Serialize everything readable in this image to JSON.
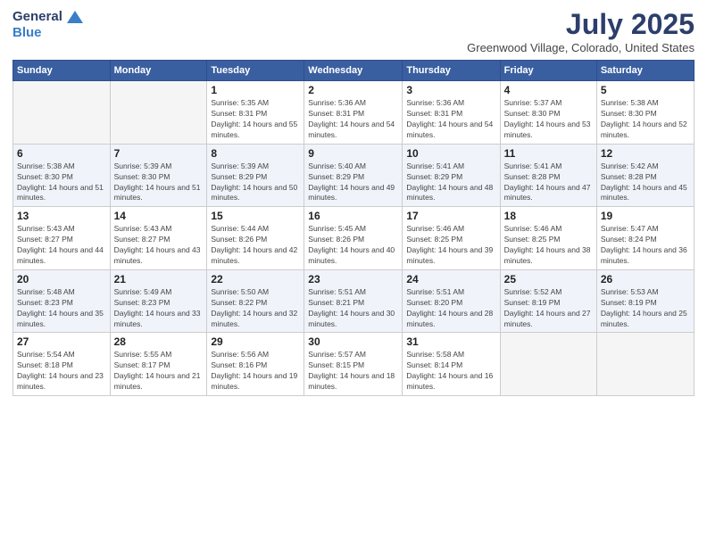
{
  "logo": {
    "general": "General",
    "blue": "Blue"
  },
  "title": "July 2025",
  "location": "Greenwood Village, Colorado, United States",
  "days_header": [
    "Sunday",
    "Monday",
    "Tuesday",
    "Wednesday",
    "Thursday",
    "Friday",
    "Saturday"
  ],
  "weeks": [
    [
      {
        "day": "",
        "info": ""
      },
      {
        "day": "",
        "info": ""
      },
      {
        "day": "1",
        "info": "Sunrise: 5:35 AM\nSunset: 8:31 PM\nDaylight: 14 hours and 55 minutes."
      },
      {
        "day": "2",
        "info": "Sunrise: 5:36 AM\nSunset: 8:31 PM\nDaylight: 14 hours and 54 minutes."
      },
      {
        "day": "3",
        "info": "Sunrise: 5:36 AM\nSunset: 8:31 PM\nDaylight: 14 hours and 54 minutes."
      },
      {
        "day": "4",
        "info": "Sunrise: 5:37 AM\nSunset: 8:30 PM\nDaylight: 14 hours and 53 minutes."
      },
      {
        "day": "5",
        "info": "Sunrise: 5:38 AM\nSunset: 8:30 PM\nDaylight: 14 hours and 52 minutes."
      }
    ],
    [
      {
        "day": "6",
        "info": "Sunrise: 5:38 AM\nSunset: 8:30 PM\nDaylight: 14 hours and 51 minutes."
      },
      {
        "day": "7",
        "info": "Sunrise: 5:39 AM\nSunset: 8:30 PM\nDaylight: 14 hours and 51 minutes."
      },
      {
        "day": "8",
        "info": "Sunrise: 5:39 AM\nSunset: 8:29 PM\nDaylight: 14 hours and 50 minutes."
      },
      {
        "day": "9",
        "info": "Sunrise: 5:40 AM\nSunset: 8:29 PM\nDaylight: 14 hours and 49 minutes."
      },
      {
        "day": "10",
        "info": "Sunrise: 5:41 AM\nSunset: 8:29 PM\nDaylight: 14 hours and 48 minutes."
      },
      {
        "day": "11",
        "info": "Sunrise: 5:41 AM\nSunset: 8:28 PM\nDaylight: 14 hours and 47 minutes."
      },
      {
        "day": "12",
        "info": "Sunrise: 5:42 AM\nSunset: 8:28 PM\nDaylight: 14 hours and 45 minutes."
      }
    ],
    [
      {
        "day": "13",
        "info": "Sunrise: 5:43 AM\nSunset: 8:27 PM\nDaylight: 14 hours and 44 minutes."
      },
      {
        "day": "14",
        "info": "Sunrise: 5:43 AM\nSunset: 8:27 PM\nDaylight: 14 hours and 43 minutes."
      },
      {
        "day": "15",
        "info": "Sunrise: 5:44 AM\nSunset: 8:26 PM\nDaylight: 14 hours and 42 minutes."
      },
      {
        "day": "16",
        "info": "Sunrise: 5:45 AM\nSunset: 8:26 PM\nDaylight: 14 hours and 40 minutes."
      },
      {
        "day": "17",
        "info": "Sunrise: 5:46 AM\nSunset: 8:25 PM\nDaylight: 14 hours and 39 minutes."
      },
      {
        "day": "18",
        "info": "Sunrise: 5:46 AM\nSunset: 8:25 PM\nDaylight: 14 hours and 38 minutes."
      },
      {
        "day": "19",
        "info": "Sunrise: 5:47 AM\nSunset: 8:24 PM\nDaylight: 14 hours and 36 minutes."
      }
    ],
    [
      {
        "day": "20",
        "info": "Sunrise: 5:48 AM\nSunset: 8:23 PM\nDaylight: 14 hours and 35 minutes."
      },
      {
        "day": "21",
        "info": "Sunrise: 5:49 AM\nSunset: 8:23 PM\nDaylight: 14 hours and 33 minutes."
      },
      {
        "day": "22",
        "info": "Sunrise: 5:50 AM\nSunset: 8:22 PM\nDaylight: 14 hours and 32 minutes."
      },
      {
        "day": "23",
        "info": "Sunrise: 5:51 AM\nSunset: 8:21 PM\nDaylight: 14 hours and 30 minutes."
      },
      {
        "day": "24",
        "info": "Sunrise: 5:51 AM\nSunset: 8:20 PM\nDaylight: 14 hours and 28 minutes."
      },
      {
        "day": "25",
        "info": "Sunrise: 5:52 AM\nSunset: 8:19 PM\nDaylight: 14 hours and 27 minutes."
      },
      {
        "day": "26",
        "info": "Sunrise: 5:53 AM\nSunset: 8:19 PM\nDaylight: 14 hours and 25 minutes."
      }
    ],
    [
      {
        "day": "27",
        "info": "Sunrise: 5:54 AM\nSunset: 8:18 PM\nDaylight: 14 hours and 23 minutes."
      },
      {
        "day": "28",
        "info": "Sunrise: 5:55 AM\nSunset: 8:17 PM\nDaylight: 14 hours and 21 minutes."
      },
      {
        "day": "29",
        "info": "Sunrise: 5:56 AM\nSunset: 8:16 PM\nDaylight: 14 hours and 19 minutes."
      },
      {
        "day": "30",
        "info": "Sunrise: 5:57 AM\nSunset: 8:15 PM\nDaylight: 14 hours and 18 minutes."
      },
      {
        "day": "31",
        "info": "Sunrise: 5:58 AM\nSunset: 8:14 PM\nDaylight: 14 hours and 16 minutes."
      },
      {
        "day": "",
        "info": ""
      },
      {
        "day": "",
        "info": ""
      }
    ]
  ]
}
